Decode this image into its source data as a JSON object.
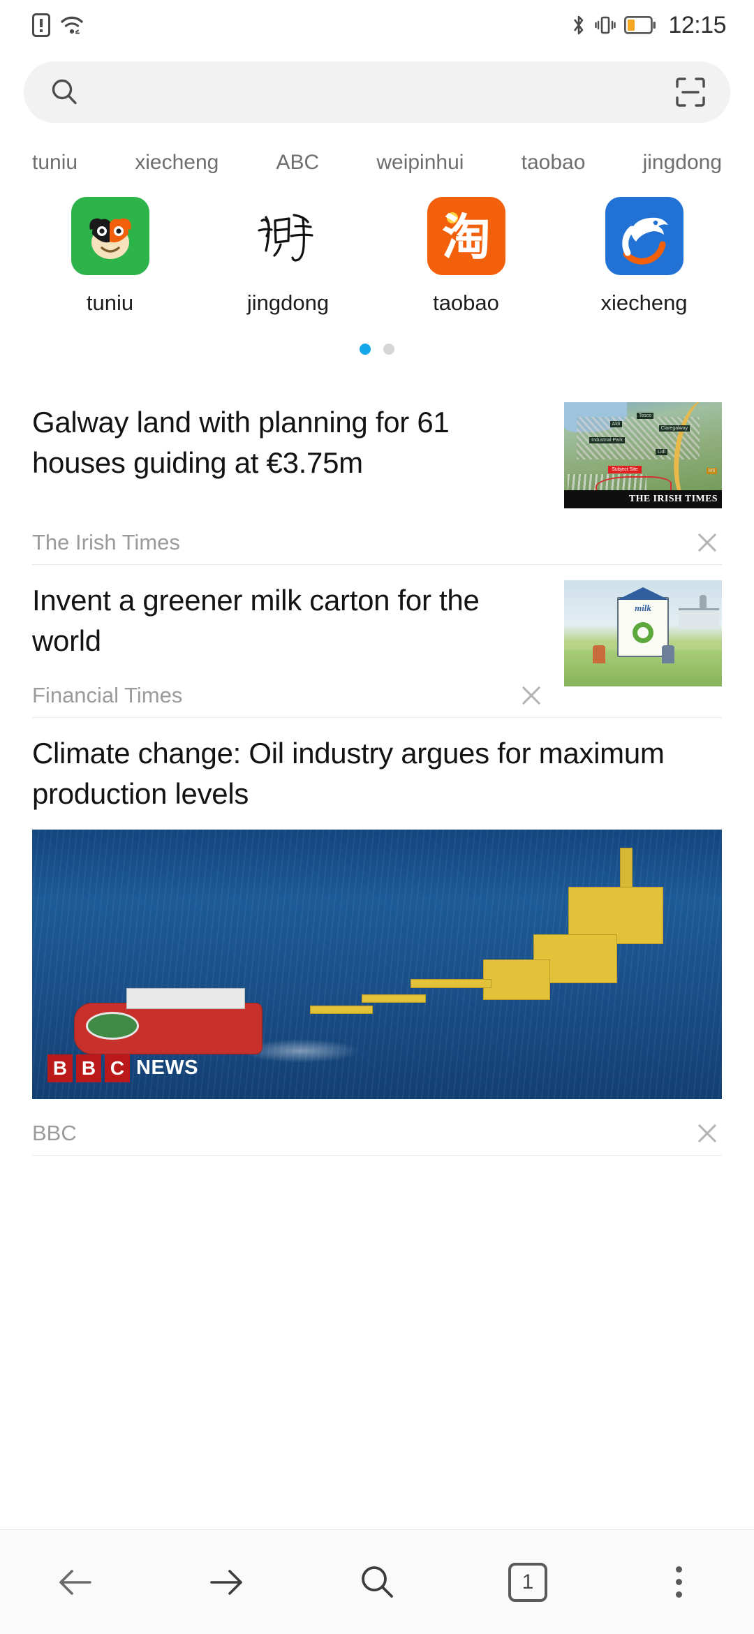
{
  "status_bar": {
    "time": "12:15",
    "left_icons": [
      "sim-card-warning-icon",
      "wifi-icon"
    ],
    "right_icons": [
      "bluetooth-icon",
      "vibrate-icon",
      "battery-low-icon"
    ],
    "battery_color": "#F5A623"
  },
  "search": {
    "value": "",
    "placeholder": "",
    "search_icon": "search-icon",
    "scan_icon": "qr-scan-icon"
  },
  "hot_keywords": [
    {
      "label": "tuniu"
    },
    {
      "label": "xiecheng"
    },
    {
      "label": "ABC"
    },
    {
      "label": "weipinhui"
    },
    {
      "label": "taobao"
    },
    {
      "label": "jingdong"
    }
  ],
  "apps": [
    {
      "label": "tuniu",
      "icon": "tuniu-cow-icon",
      "color": "#2CB34A"
    },
    {
      "label": "jingdong",
      "icon": "zhihu-script-icon",
      "color": "#FFFFFF",
      "glyph": "知乎"
    },
    {
      "label": "taobao",
      "icon": "taobao-icon",
      "color": "#F3600B",
      "glyph": "淘"
    },
    {
      "label": "xiecheng",
      "icon": "ctrip-dolphin-icon",
      "color": "#2272D6"
    }
  ],
  "pager": {
    "total": 2,
    "active_index": 0,
    "active_color": "#13A6E8",
    "inactive_color": "#D6D6D6"
  },
  "news": [
    {
      "title": "Galway land with planning for 61 houses guiding at €3.75m",
      "source": "The Irish Times",
      "thumbnail": "aerial-map-thumbnail",
      "thumb_watermark": "THE IRISH TIMES",
      "thumb_labels": [
        "Tesco",
        "Aldi",
        "Claregalway",
        "Industrial Park",
        "Lidl",
        "M6"
      ],
      "thumb_subject_label": "Subject Site",
      "close_icon": "close-icon"
    },
    {
      "title": "Invent a greener milk carton for the world",
      "source": "Financial Times",
      "thumbnail": "milk-carton-cartoon-thumbnail",
      "thumb_word": "milk",
      "close_icon": "close-icon"
    },
    {
      "title": "Climate change: Oil industry argues for maximum production levels",
      "source": "BBC",
      "thumbnail": "oil-rig-photo",
      "photo_logo_blocks": [
        "B",
        "B",
        "C"
      ],
      "photo_logo_text": "NEWS",
      "photo_logo_color": "#BB1919",
      "close_icon": "close-icon"
    }
  ],
  "bottom_nav": [
    {
      "name": "back",
      "icon": "arrow-left-icon"
    },
    {
      "name": "forward",
      "icon": "arrow-right-icon"
    },
    {
      "name": "search",
      "icon": "search-icon"
    },
    {
      "name": "tabs",
      "icon": "tab-count-icon",
      "count": "1"
    },
    {
      "name": "menu",
      "icon": "kebab-menu-icon"
    }
  ]
}
